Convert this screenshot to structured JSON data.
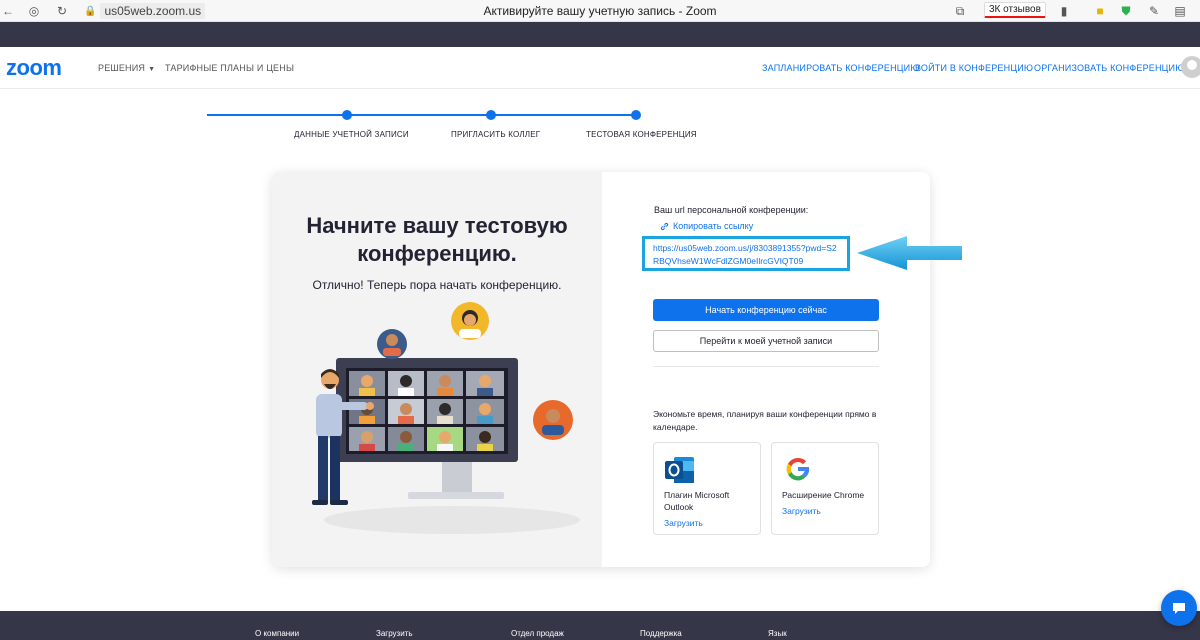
{
  "browser": {
    "url": "us05web.zoom.us",
    "tab_title": "Активируйте вашу учетную запись - Zoom",
    "reviews_badge": "3К отзывов"
  },
  "header": {
    "logo": "zoom",
    "nav_left": [
      "РЕШЕНИЯ",
      "ТАРИФНЫЕ ПЛАНЫ И ЦЕНЫ"
    ],
    "nav_right": [
      "ЗАПЛАНИРОВАТЬ КОНФЕРЕНЦИЮ",
      "ВОЙТИ В КОНФЕРЕНЦИЮ",
      "ОРГАНИЗОВАТЬ КОНФЕРЕНЦИЮ"
    ]
  },
  "stepper": {
    "steps": [
      "ДАННЫЕ УЧЕТНОЙ ЗАПИСИ",
      "ПРИГЛАСИТЬ КОЛЛЕГ",
      "ТЕСТОВАЯ КОНФЕРЕНЦИЯ"
    ]
  },
  "left": {
    "headline_line1": "Начните вашу тестовую",
    "headline_line2": "конференцию.",
    "subline": "Отлично! Теперь пора начать конференцию."
  },
  "right": {
    "url_label": "Ваш url персональной конференции:",
    "copy_link": "Копировать ссылку",
    "personal_url": "https://us05web.zoom.us/j/8303891355?pwd=S2RBQVhseW1WcFdlZGM0eIlrcGVIQT09",
    "start_button": "Начать конференцию сейчас",
    "account_button": "Перейти к моей учетной записи",
    "save_time": "Экономьте время, планируя ваши конференции прямо в календаре.",
    "extensions": [
      {
        "name": "Плагин Microsoft Outlook",
        "download": "Загрузить"
      },
      {
        "name": "Расширение Chrome",
        "download": "Загрузить"
      }
    ]
  },
  "footer": {
    "links": [
      "О компании",
      "Загрузить",
      "Отдел продаж",
      "Поддержка",
      "Язык"
    ]
  },
  "colors": {
    "brand": "#0e72ed",
    "dark_bar": "#363649",
    "highlight": "#1aa5e0"
  }
}
